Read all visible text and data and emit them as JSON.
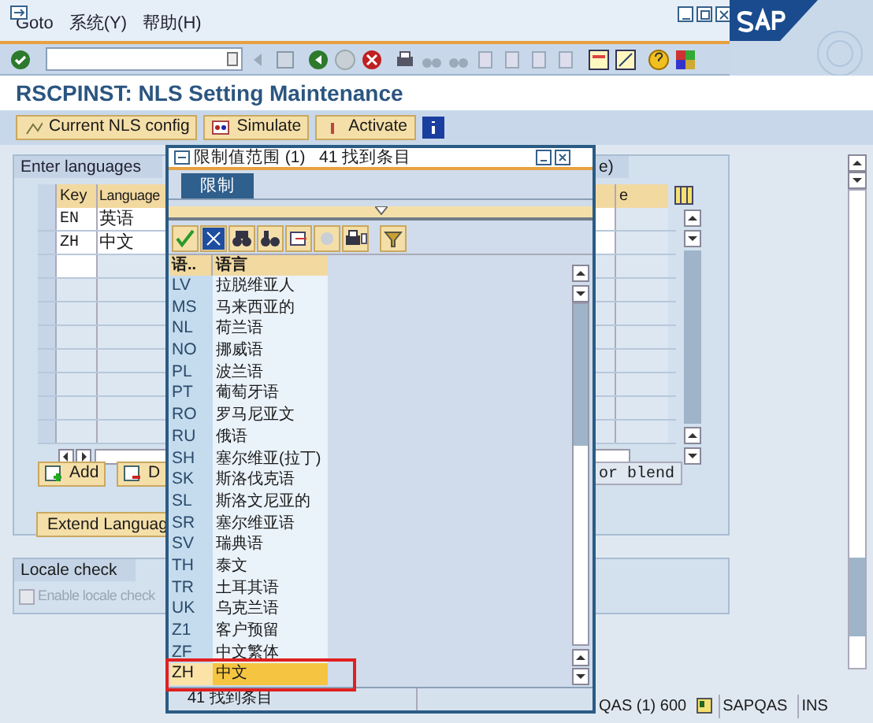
{
  "menu": [
    {
      "label": "Goto"
    },
    {
      "label": "系统(Y)"
    },
    {
      "label": "帮助(H)"
    }
  ],
  "title": "RSCPINST: NLS Setting Maintenance",
  "app_toolbar": [
    {
      "label": "Current NLS config"
    },
    {
      "label": "Simulate"
    },
    {
      "label": "Activate"
    }
  ],
  "languages_group": {
    "title": "Enter languages",
    "title_tail": "e)",
    "columns": [
      "Key",
      "Language"
    ],
    "column_tail": "e",
    "rows": [
      {
        "key": "EN",
        "language": "英语"
      },
      {
        "key": "ZH",
        "language": "中文"
      }
    ]
  },
  "buttons": [
    {
      "label": "Add"
    },
    {
      "label": "D"
    },
    {
      "label": "Extend Languag"
    }
  ],
  "right_button": "or blend",
  "locale_check": {
    "title": "Locale check",
    "checkbox": {
      "label": "Enable locale check",
      "checked": false,
      "disabled": true
    }
  },
  "status_bar": {
    "system": "QAS (1) 600",
    "server": "SAPQAS",
    "mode": "INS"
  },
  "popup": {
    "title": "限制值范围 (1)   41 找到条目",
    "tabs": [
      {
        "label": "限制",
        "selected": true
      }
    ],
    "columns": [
      "语..",
      "语言"
    ],
    "rows": [
      {
        "code": "LV",
        "name": "拉脱维亚人",
        "selected": false
      },
      {
        "code": "MS",
        "name": "马来西亚的",
        "selected": false
      },
      {
        "code": "NL",
        "name": "荷兰语",
        "selected": false
      },
      {
        "code": "NO",
        "name": "挪威语",
        "selected": false
      },
      {
        "code": "PL",
        "name": "波兰语",
        "selected": false
      },
      {
        "code": "PT",
        "name": "葡萄牙语",
        "selected": false
      },
      {
        "code": "RO",
        "name": "罗马尼亚文",
        "selected": false
      },
      {
        "code": "RU",
        "name": "俄语",
        "selected": false
      },
      {
        "code": "SH",
        "name": "塞尔维亚(拉丁)",
        "selected": false
      },
      {
        "code": "SK",
        "name": "斯洛伐克语",
        "selected": false
      },
      {
        "code": "SL",
        "name": "斯洛文尼亚的",
        "selected": false
      },
      {
        "code": "SR",
        "name": "塞尔维亚语",
        "selected": false
      },
      {
        "code": "SV",
        "name": "瑞典语",
        "selected": false
      },
      {
        "code": "TH",
        "name": "泰文",
        "selected": false
      },
      {
        "code": "TR",
        "name": "土耳其语",
        "selected": false
      },
      {
        "code": "UK",
        "name": "乌克兰语",
        "selected": false
      },
      {
        "code": "Z1",
        "name": "客户预留",
        "selected": false
      },
      {
        "code": "ZF",
        "name": "中文繁体",
        "selected": false
      },
      {
        "code": "ZH",
        "name": "中文",
        "selected": true
      }
    ],
    "status": "41 找到条目"
  }
}
